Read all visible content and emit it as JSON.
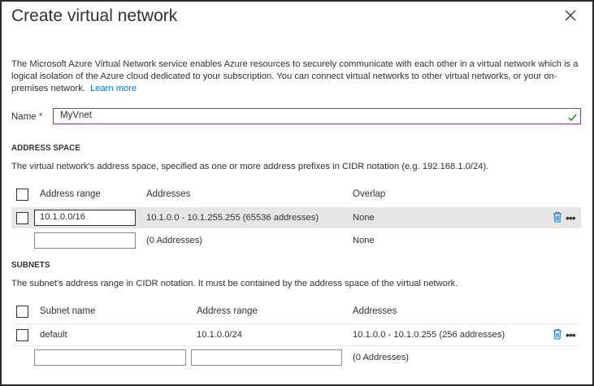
{
  "panel": {
    "title": "Create virtual network",
    "description": "The Microsoft Azure Virtual Network service enables Azure resources to securely communicate with each other in a virtual network which is a logical isolation of the Azure cloud dedicated to your subscription. You can connect virtual networks to other virtual networks, or your on-premises network.",
    "learn_more": "Learn more"
  },
  "name_field": {
    "label": "Name",
    "required_mark": "*",
    "value": "MyVnet"
  },
  "address_space": {
    "heading": "ADDRESS SPACE",
    "description": "The virtual network's address space, specified as one or more address prefixes in CIDR notation (e.g. 192.168.1.0/24).",
    "columns": {
      "range": "Address range",
      "addresses": "Addresses",
      "overlap": "Overlap"
    },
    "rows": [
      {
        "range": "10.1.0.0/16",
        "addresses": "10.1.0.0 - 10.1.255.255 (65536 addresses)",
        "overlap": "None"
      },
      {
        "range": "",
        "addresses": "(0 Addresses)",
        "overlap": "None"
      }
    ]
  },
  "subnets": {
    "heading": "SUBNETS",
    "description": "The subnet's address range in CIDR notation. It must be contained by the address space of the virtual network.",
    "columns": {
      "name": "Subnet name",
      "range": "Address range",
      "addresses": "Addresses"
    },
    "rows": [
      {
        "name": "default",
        "range": "10.1.0.0/24",
        "addresses": "10.1.0.0 - 10.1.0.255 (256 addresses)"
      },
      {
        "name": "",
        "range": "",
        "addresses": "(0 Addresses)"
      }
    ]
  },
  "icons": {
    "close": "close-icon",
    "check": "check-icon",
    "delete": "trash-icon",
    "more": "more-icon"
  },
  "colors": {
    "accent": "#0078d4",
    "focus_border": "#8a3a8c",
    "selected_row": "#e6e6e6",
    "valid_check": "#107c10"
  }
}
